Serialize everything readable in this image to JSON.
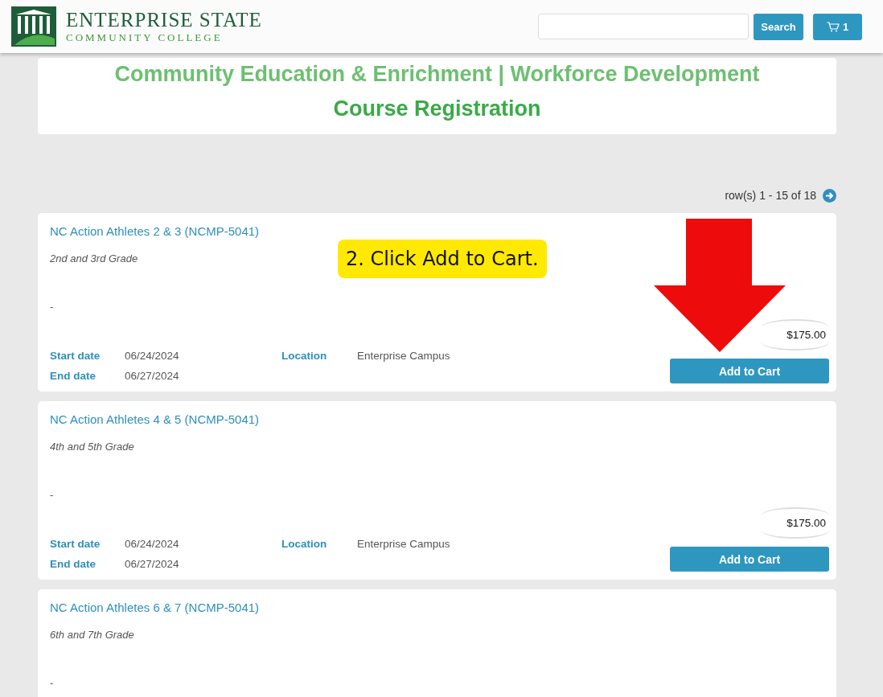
{
  "header": {
    "logo_title": "ENTERPRISE STATE",
    "logo_subtitle": "COMMUNITY COLLEGE",
    "search_button": "Search",
    "cart_count": "1"
  },
  "banner": {
    "subtitle": "Community Education & Enrichment | Workforce Development",
    "title": "Course Registration"
  },
  "pager": {
    "text": "row(s) 1 - 15 of 18"
  },
  "courses": [
    {
      "title": "NC Action Athletes 2 & 3 (NCMP-5041)",
      "grade": "2nd and 3rd Grade",
      "description": "-",
      "start_label": "Start date",
      "start": "06/24/2024",
      "end_label": "End date",
      "end": "06/27/2024",
      "location_label": "Location",
      "location": "Enterprise Campus",
      "price": "$175.00",
      "button": "Add to Cart"
    },
    {
      "title": "NC Action Athletes 4 & 5 (NCMP-5041)",
      "grade": "4th and 5th Grade",
      "description": "-",
      "start_label": "Start date",
      "start": "06/24/2024",
      "end_label": "End date",
      "end": "06/27/2024",
      "location_label": "Location",
      "location": "Enterprise Campus",
      "price": "$175.00",
      "button": "Add to Cart"
    },
    {
      "title": "NC Action Athletes 6 & 7 (NCMP-5041)",
      "grade": "6th and 7th Grade",
      "description": "-"
    }
  ],
  "annotation": {
    "callout": "2. Click Add to Cart."
  }
}
